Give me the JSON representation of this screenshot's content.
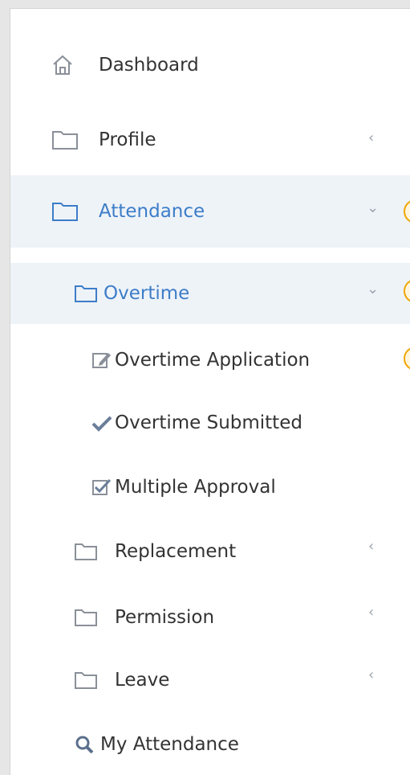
{
  "nav": {
    "dashboard": {
      "label": "Dashboard",
      "icon": "home-icon"
    },
    "profile": {
      "label": "Profile",
      "icon": "folder-icon"
    },
    "attendance": {
      "label": "Attendance",
      "icon": "folder-icon"
    },
    "overtime": {
      "label": "Overtime",
      "icon": "folder-icon"
    },
    "overtime_application": {
      "label": "Overtime Application",
      "icon": "edit-icon"
    },
    "overtime_submitted": {
      "label": "Overtime Submitted",
      "icon": "check-icon"
    },
    "multiple_approval": {
      "label": "Multiple Approval",
      "icon": "checkbox-icon"
    },
    "replacement": {
      "label": "Replacement",
      "icon": "folder-icon"
    },
    "permission": {
      "label": "Permission",
      "icon": "folder-icon"
    },
    "leave": {
      "label": "Leave",
      "icon": "folder-icon"
    },
    "my_attendance": {
      "label": "My Attendance",
      "icon": "search-icon"
    }
  },
  "colors": {
    "active_text": "#3d7dc8",
    "active_bg": "#eef3f8",
    "text": "#333333",
    "muted": "#9aa3ad",
    "badge": "#f0a500"
  }
}
